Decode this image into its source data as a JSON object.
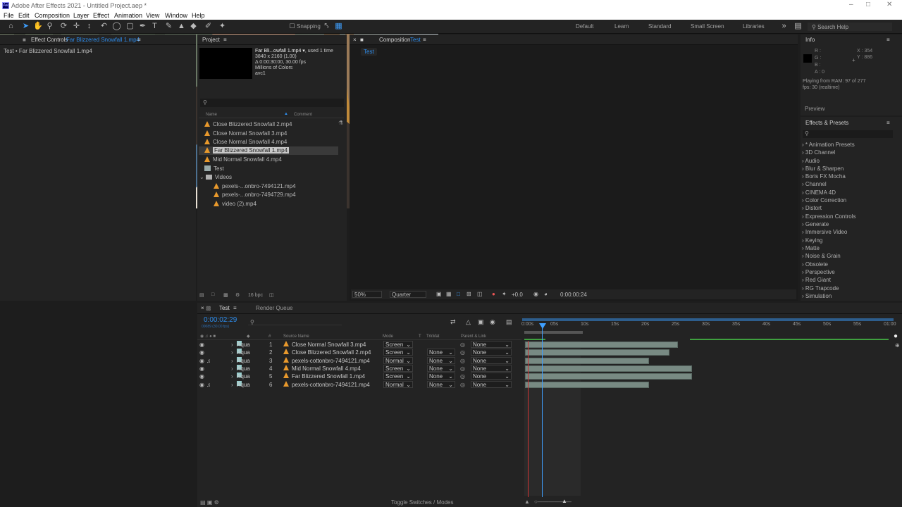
{
  "app": {
    "title": "Adobe After Effects 2021 - Untitled Project.aep *"
  },
  "menu": [
    "File",
    "Edit",
    "Composition",
    "Layer",
    "Effect",
    "Animation",
    "View",
    "Window",
    "Help"
  ],
  "toolbar": {
    "snapping": "Snapping"
  },
  "workspaces": [
    "Default",
    "Learn",
    "Standard",
    "Small Screen",
    "Libraries"
  ],
  "search_help": "Search Help",
  "effect_controls": {
    "tab": "Effect Controls",
    "target": "Far Blizzered Snowfall 1.mp4",
    "breadcrumb": "Test • Far Blizzered Snowfall 1.mp4"
  },
  "project": {
    "tab": "Project",
    "info_name": "Far Bli...owfall 1.mp4 ▾",
    "used": ", used 1 time",
    "dims": "3840 x 2160 (1.00)",
    "dur": "Δ 0:00:30:00, 30.00 fps",
    "colors": "Millions of Colors",
    "codec": "avc1",
    "col_name": "Name",
    "col_comment": "Comment",
    "items": [
      {
        "name": "Close Blizzered Snowfall 2.mp4",
        "type": "video"
      },
      {
        "name": "Close Normal Snowfall 3.mp4",
        "type": "video"
      },
      {
        "name": "Close Normal Snowfall 4.mp4",
        "type": "video"
      },
      {
        "name": "Far Blizzered Snowfall 1.mp4",
        "type": "video"
      },
      {
        "name": "Mid Normal Snowfall 4.mp4",
        "type": "video"
      },
      {
        "name": "Test",
        "type": "comp"
      },
      {
        "name": "Videos",
        "type": "folder"
      },
      {
        "name": "pexels-...onbro-7494121.mp4",
        "type": "video"
      },
      {
        "name": "pexels-...onbro-7494729.mp4",
        "type": "video"
      },
      {
        "name": "video (2).mp4",
        "type": "video"
      }
    ],
    "bpc": "16 bpc"
  },
  "composition": {
    "tab": "Composition",
    "name": "Test",
    "sub_tab": "Test",
    "zoom": "50%",
    "resolution": "Quarter",
    "exposure": "+0.0",
    "timecode": "0:00:00:24"
  },
  "info": {
    "tab": "Info",
    "r": "R :",
    "g": "G :",
    "b": "B :",
    "a": "A :  0",
    "x": "X : 354",
    "y": "Y : 886",
    "playing": "Playing from RAM: 97 of 277",
    "fps": "fps: 30 (realtime)",
    "preview": "Preview"
  },
  "effects": {
    "tab": "Effects & Presets",
    "items": [
      "* Animation Presets",
      "3D Channel",
      "Audio",
      "Blur & Sharpen",
      "Boris FX Mocha",
      "Channel",
      "CINEMA 4D",
      "Color Correction",
      "Distort",
      "Expression Controls",
      "Generate",
      "Immersive Video",
      "Keying",
      "Matte",
      "Noise & Grain",
      "Obsolete",
      "Perspective",
      "Red Giant",
      "RG Trapcode",
      "Simulation"
    ]
  },
  "timeline": {
    "tab": "Test",
    "render_tab": "Render Queue",
    "timecode": "0:00:02:29",
    "frames": "00089 (30.00 fps)",
    "cols": {
      "num": "#",
      "source": "Source Name",
      "mode": "Mode",
      "t": "T",
      "trkmat": "TrkMat",
      "parent": "Parent & Link"
    },
    "ticks": [
      "0:00s",
      "05s",
      "10s",
      "15s",
      "20s",
      "25s",
      "30s",
      "35s",
      "40s",
      "45s",
      "50s",
      "55s",
      "01:00"
    ],
    "layers": [
      {
        "label": "Aqua",
        "num": "1",
        "name": "Close Normal Snowfall 3.mp4",
        "mode": "Screen",
        "trkmat": "",
        "parent": "None",
        "audio": false,
        "start": 0,
        "end": 25.2
      },
      {
        "label": "Aqua",
        "num": "2",
        "name": "Close Blizzered Snowfall 2.mp4",
        "mode": "Screen",
        "trkmat": "None",
        "parent": "None",
        "audio": false,
        "start": 0,
        "end": 23.8
      },
      {
        "label": "Aqua",
        "num": "3",
        "name": "pexels-cottonbro-7494121.mp4",
        "mode": "Normal",
        "trkmat": "None",
        "parent": "None",
        "audio": true,
        "start": 0,
        "end": 20.5
      },
      {
        "label": "Aqua",
        "num": "4",
        "name": "Mid Normal Snowfall 4.mp4",
        "mode": "Screen",
        "trkmat": "None",
        "parent": "None",
        "audio": false,
        "start": 0,
        "end": 27.5
      },
      {
        "label": "Aqua",
        "num": "5",
        "name": "Far Blizzered Snowfall 1.mp4",
        "mode": "Screen",
        "trkmat": "None",
        "parent": "None",
        "audio": false,
        "start": 0,
        "end": 27.5
      },
      {
        "label": "Aqua",
        "num": "6",
        "name": "pexels-cottonbro-7494121.mp4",
        "mode": "Normal",
        "trkmat": "None",
        "parent": "None",
        "audio": true,
        "start": 0,
        "end": 20.5
      }
    ],
    "toggle": "Toggle Switches / Modes"
  },
  "colors": {
    "accent": "#2d8ceb",
    "playhead": "#3fa0ff",
    "bar": "#788a83",
    "label_aqua": "#9cc"
  }
}
